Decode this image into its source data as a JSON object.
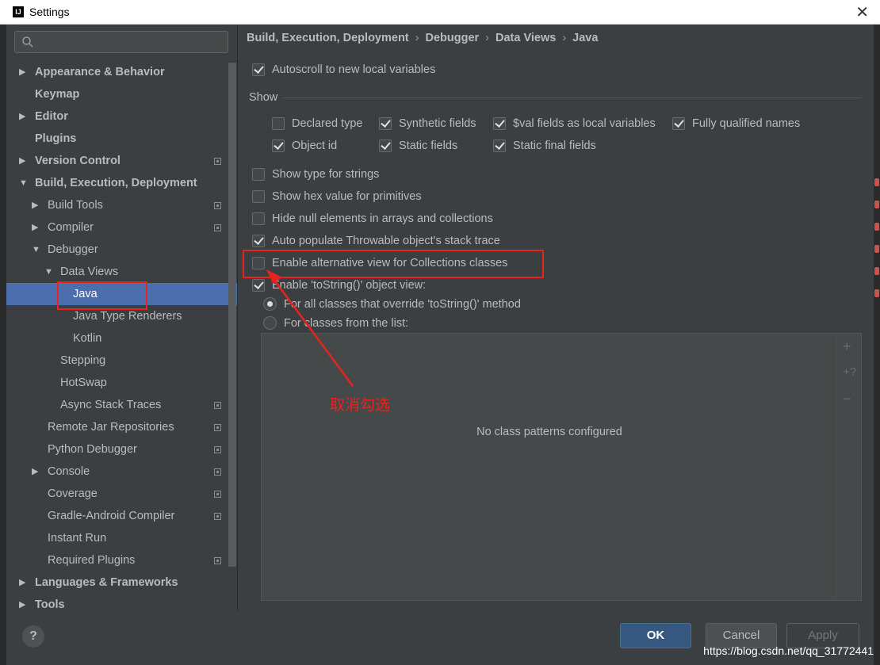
{
  "window": {
    "title": "Settings",
    "app_icon": "intellij-icon",
    "close_glyph": "✕"
  },
  "search": {
    "placeholder": "",
    "value": ""
  },
  "tree": [
    {
      "label": "Appearance & Behavior",
      "bold": true,
      "arrow": "right",
      "project": false
    },
    {
      "label": "Keymap",
      "bold": true,
      "arrow": "",
      "project": false
    },
    {
      "label": "Editor",
      "bold": true,
      "arrow": "right",
      "project": false
    },
    {
      "label": "Plugins",
      "bold": true,
      "arrow": "",
      "project": false
    },
    {
      "label": "Version Control",
      "bold": true,
      "arrow": "right",
      "project": true
    },
    {
      "label": "Build, Execution, Deployment",
      "bold": true,
      "arrow": "down",
      "project": false
    },
    {
      "label": "Build Tools",
      "bold": false,
      "arrow": "right",
      "project": true
    },
    {
      "label": "Compiler",
      "bold": false,
      "arrow": "right",
      "project": true
    },
    {
      "label": "Debugger",
      "bold": false,
      "arrow": "down",
      "project": false
    },
    {
      "label": "Data Views",
      "bold": false,
      "arrow": "down",
      "project": false
    },
    {
      "label": "Java",
      "bold": false,
      "arrow": "",
      "project": false,
      "selected": true
    },
    {
      "label": "Java Type Renderers",
      "bold": false,
      "arrow": "",
      "project": false
    },
    {
      "label": "Kotlin",
      "bold": false,
      "arrow": "",
      "project": false
    },
    {
      "label": "Stepping",
      "bold": false,
      "arrow": "",
      "project": false
    },
    {
      "label": "HotSwap",
      "bold": false,
      "arrow": "",
      "project": false
    },
    {
      "label": "Async Stack Traces",
      "bold": false,
      "arrow": "",
      "project": true
    },
    {
      "label": "Remote Jar Repositories",
      "bold": false,
      "arrow": "",
      "project": true
    },
    {
      "label": "Python Debugger",
      "bold": false,
      "arrow": "",
      "project": true
    },
    {
      "label": "Console",
      "bold": false,
      "arrow": "right",
      "project": true
    },
    {
      "label": "Coverage",
      "bold": false,
      "arrow": "",
      "project": true
    },
    {
      "label": "Gradle-Android Compiler",
      "bold": false,
      "arrow": "",
      "project": true
    },
    {
      "label": "Instant Run",
      "bold": false,
      "arrow": "",
      "project": false
    },
    {
      "label": "Required Plugins",
      "bold": false,
      "arrow": "",
      "project": true
    },
    {
      "label": "Languages & Frameworks",
      "bold": true,
      "arrow": "right",
      "project": false
    },
    {
      "label": "Tools",
      "bold": true,
      "arrow": "right",
      "project": false
    }
  ],
  "breadcrumb": [
    "Build, Execution, Deployment",
    "Debugger",
    "Data Views",
    "Java"
  ],
  "breadcrumb_separator": "›",
  "options": {
    "autoscroll": {
      "label": "Autoscroll to new local variables",
      "checked": true
    },
    "show_group_label": "Show",
    "show": {
      "declared_type": {
        "label": "Declared type",
        "checked": false
      },
      "synthetic_fields": {
        "label": "Synthetic fields",
        "checked": true
      },
      "val_fields": {
        "label": "$val fields as local variables",
        "checked": true
      },
      "fully_qualified": {
        "label": "Fully qualified names",
        "checked": true
      },
      "object_id": {
        "label": "Object id",
        "checked": true
      },
      "static_fields": {
        "label": "Static fields",
        "checked": true
      },
      "static_final_fields": {
        "label": "Static final fields",
        "checked": true
      }
    },
    "type_for_strings": {
      "label": "Show type for strings",
      "checked": false
    },
    "hex_primitives": {
      "label": "Show hex value for primitives",
      "checked": false
    },
    "hide_null": {
      "label": "Hide null elements in arrays and collections",
      "checked": false
    },
    "auto_populate": {
      "label": "Auto populate Throwable object's stack trace",
      "checked": true
    },
    "alt_collections": {
      "label": "Enable alternative view for Collections classes",
      "checked": false
    },
    "tostring": {
      "label": "Enable 'toString()' object view:",
      "checked": true
    },
    "tostring_all": {
      "label": "For all classes that override 'toString()' method",
      "selected": true
    },
    "tostring_list": {
      "label": "For classes from the list:",
      "selected": false
    }
  },
  "class_list": {
    "empty_text": "No class patterns configured",
    "add_glyph": "+",
    "add_pattern_glyph": "+?",
    "remove_glyph": "−"
  },
  "annotation": {
    "text": "取消勾选",
    "color": "#e8231d"
  },
  "buttons": {
    "help": "?",
    "ok": "OK",
    "cancel": "Cancel",
    "apply": "Apply"
  },
  "watermark": "https://blog.csdn.net/qq_31772441",
  "colors": {
    "background": "#3c3f41",
    "selection": "#4b6eaf",
    "ok_button": "#365880",
    "annotation_red": "#e8231d"
  }
}
